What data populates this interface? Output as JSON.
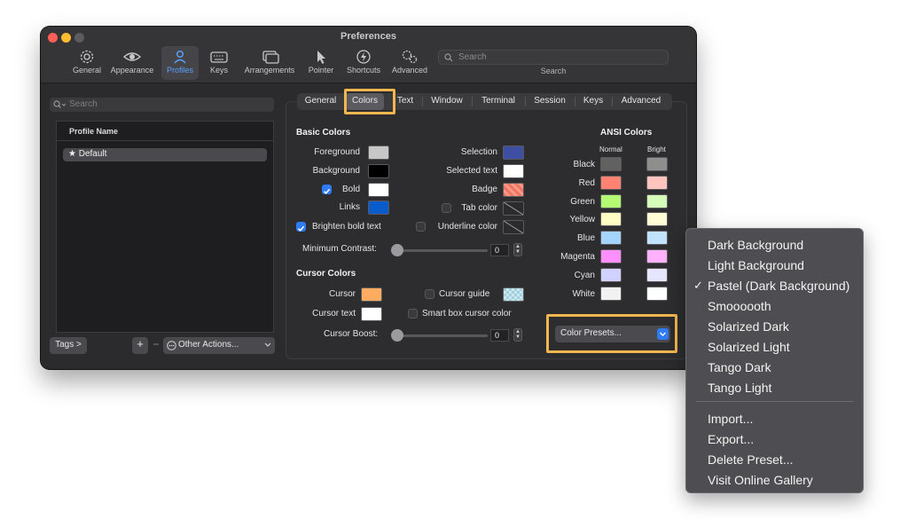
{
  "window": {
    "title": "Preferences",
    "traffic_lights": [
      "#ff5f57",
      "#febc2e",
      "#5c5b5f"
    ]
  },
  "toolbar": {
    "items": [
      {
        "label": "General",
        "icon": "gear-icon"
      },
      {
        "label": "Appearance",
        "icon": "eye-icon"
      },
      {
        "label": "Profiles",
        "icon": "person-icon",
        "active": true
      },
      {
        "label": "Keys",
        "icon": "keyboard-icon"
      },
      {
        "label": "Arrangements",
        "icon": "windows-icon"
      },
      {
        "label": "Pointer",
        "icon": "pointer-icon"
      },
      {
        "label": "Shortcuts",
        "icon": "lightning-icon"
      },
      {
        "label": "Advanced",
        "icon": "gears-icon"
      }
    ],
    "search_placeholder": "Search",
    "search_caption": "Search"
  },
  "sidebar": {
    "search_placeholder": "Search",
    "column_header": "Profile Name",
    "profiles": [
      {
        "name": "★ Default"
      }
    ],
    "tags_button": "Tags >",
    "add_button": "+",
    "remove_button": "−",
    "other_actions": "Other Actions..."
  },
  "tabs": [
    "General",
    "Colors",
    "Text",
    "Window",
    "Terminal",
    "Session",
    "Keys",
    "Advanced"
  ],
  "active_tab": "Colors",
  "basic_colors": {
    "heading": "Basic Colors",
    "foreground": "Foreground",
    "background": "Background",
    "bold": "Bold",
    "links": "Links",
    "brighten": "Brighten bold text",
    "min_contrast": "Minimum Contrast:",
    "min_contrast_value": "0",
    "selection": "Selection",
    "selected_text": "Selected text",
    "badge": "Badge",
    "tab_color": "Tab color",
    "underline_color": "Underline color",
    "swatches": {
      "foreground": "#c7c7c7",
      "background": "#000000",
      "bold": "#ffffff",
      "links": "#0a5bcc",
      "selection": "#3e4ea3",
      "selected_text": "#ffffff",
      "badge": "#f07462"
    }
  },
  "cursor_colors": {
    "heading": "Cursor Colors",
    "cursor": "Cursor",
    "cursor_text": "Cursor text",
    "cursor_boost": "Cursor Boost:",
    "cursor_boost_value": "0",
    "cursor_guide": "Cursor guide",
    "smart_box": "Smart box cursor color",
    "swatches": {
      "cursor": "#fdac62",
      "cursor_text": "#ffffff",
      "cursor_guide": "#c8e7f0"
    }
  },
  "ansi": {
    "heading": "ANSI Colors",
    "normal_label": "Normal",
    "bright_label": "Bright",
    "rows": [
      {
        "name": "Black",
        "normal": "#616161",
        "bright": "#8e8e8e"
      },
      {
        "name": "Red",
        "normal": "#ff8272",
        "bright": "#ffc4bd"
      },
      {
        "name": "Green",
        "normal": "#b4fa72",
        "bright": "#d6fcb9"
      },
      {
        "name": "Yellow",
        "normal": "#fefdc2",
        "bright": "#fefdd5"
      },
      {
        "name": "Blue",
        "normal": "#a5d5fe",
        "bright": "#c1e3fe"
      },
      {
        "name": "Magenta",
        "normal": "#ff8ffd",
        "bright": "#ffb1fe"
      },
      {
        "name": "Cyan",
        "normal": "#d0d1fe",
        "bright": "#e5e6fe"
      },
      {
        "name": "White",
        "normal": "#f1f1f1",
        "bright": "#feffff"
      }
    ]
  },
  "color_presets_button": "Color Presets...",
  "highlight_color": "#f1b64f",
  "menu": {
    "items": [
      {
        "label": "Dark Background"
      },
      {
        "label": "Light Background"
      },
      {
        "label": "Pastel (Dark Background)",
        "checked": true
      },
      {
        "label": "Smoooooth"
      },
      {
        "label": "Solarized Dark"
      },
      {
        "label": "Solarized Light"
      },
      {
        "label": "Tango Dark"
      },
      {
        "label": "Tango Light"
      }
    ],
    "checkmark": "✓",
    "actions": [
      {
        "label": "Import..."
      },
      {
        "label": "Export..."
      },
      {
        "label": "Delete Preset..."
      },
      {
        "label": "Visit Online Gallery"
      }
    ]
  }
}
